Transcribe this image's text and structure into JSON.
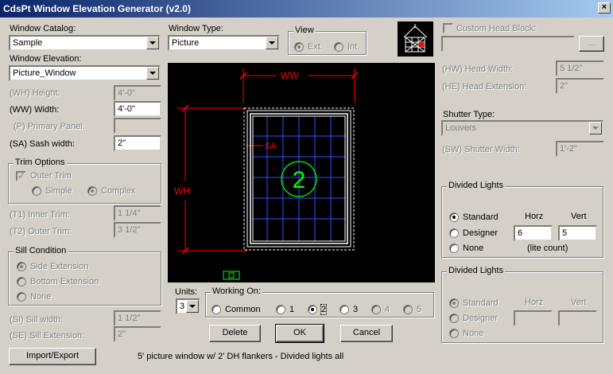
{
  "window": {
    "title": "CdsPt Window Elevation Generator (v2.0)",
    "close": "×"
  },
  "catalog": {
    "label": "Window Catalog:",
    "value": "Sample"
  },
  "elevation": {
    "label": "Window Elevation:",
    "value": "Picture_Window"
  },
  "type": {
    "label": "Window Type:",
    "value": "Picture"
  },
  "view": {
    "title": "View",
    "ext": "Ext.",
    "int": "Int."
  },
  "dims": {
    "head_height": {
      "label": "(WH) Height:",
      "value": "4'-0\""
    },
    "width": {
      "label": "(WW) Width:",
      "value": "4'-0\""
    },
    "primary_panel": {
      "label": "(P) Primary Panel:",
      "value": ""
    },
    "sash_width": {
      "label": "(SA) Sash width:",
      "value": "2\""
    }
  },
  "trim": {
    "title": "Trim Options",
    "outer_trim": "Outer Trim",
    "simple": "Simple",
    "complex": "Complex",
    "inner_trim": {
      "label": "(T1) Inner Trim:",
      "value": "1 1/4\""
    },
    "outer_trim_width": {
      "label": "(T2) Outer Trim:",
      "value": "3 1/2\""
    }
  },
  "sill": {
    "title": "Sill Condition",
    "side": "Side Extension",
    "bottom": "Bottom Extension",
    "none": "None",
    "sill_width": {
      "label": "(SI) Sill width:",
      "value": "1 1/2\""
    },
    "sill_ext": {
      "label": "(SE) Sill Extension:",
      "value": "2\""
    }
  },
  "preview": {
    "ww": "WW",
    "wh": "WH",
    "sa": "SA",
    "panel_number": "2",
    "colors": {
      "bg": "#000000",
      "dim": "#ff0000",
      "frame": "#ffffff",
      "grid": "#3050ff",
      "tag": "#00ff00"
    }
  },
  "units": {
    "label": "Units:",
    "value": "3"
  },
  "working": {
    "title": "Working On:",
    "common": "Common",
    "opt1": "1",
    "opt2": "2",
    "opt3": "3",
    "opt4": "4",
    "opt5": "5"
  },
  "buttons": {
    "delete": "Delete",
    "ok": "OK",
    "cancel": "Cancel",
    "import_export": "Import/Export",
    "browse": "..."
  },
  "status": "5' picture window w/ 2' DH flankers - Divided lights all",
  "head": {
    "custom_block": "Custom Head Block:",
    "block_value": "",
    "head_width": {
      "label": "(HW) Head Width:",
      "value": "5 1/2\""
    },
    "head_ext": {
      "label": "(HE) Head Extension:",
      "value": "2\""
    }
  },
  "shutter": {
    "label": "Shutter Type:",
    "value": "Louvers",
    "width": {
      "label": "(SW) Shutter Width:",
      "value": "1'-2\""
    }
  },
  "divided1": {
    "title": "Divided Lights",
    "standard": "Standard",
    "designer": "Designer",
    "none": "None",
    "horz_label": "Horz",
    "vert_label": "Vert",
    "horz": "6",
    "vert": "5",
    "lite_count": "(lite count)"
  },
  "divided2": {
    "title": "Divided Lights",
    "standard": "Standard",
    "designer": "Designer",
    "none": "None",
    "horz_label": "Horz",
    "vert_label": "Vert",
    "horz": "",
    "vert": ""
  }
}
